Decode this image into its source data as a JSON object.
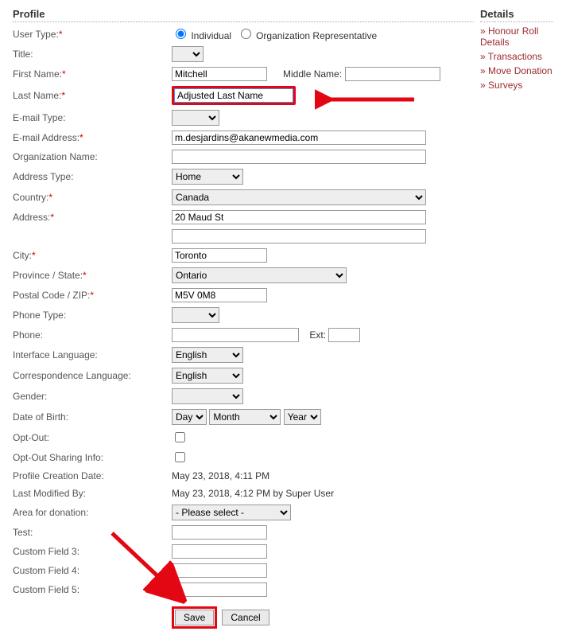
{
  "section_title_profile": "Profile",
  "section_title_details": "Details",
  "details_links": [
    "Honour Roll Details",
    "Transactions",
    "Move Donation",
    "Surveys"
  ],
  "userType": {
    "label": "User Type:",
    "req": true,
    "opt1": "Individual",
    "opt2": "Organization Representative",
    "selected": "Individual"
  },
  "title": {
    "label": "Title:",
    "value": ""
  },
  "firstName": {
    "label": "First Name:",
    "req": true,
    "value": "Mitchell"
  },
  "middleName": {
    "label": "Middle Name:",
    "value": ""
  },
  "lastName": {
    "label": "Last Name:",
    "req": true,
    "value": "Adjusted Last Name"
  },
  "emailType": {
    "label": "E-mail Type:",
    "value": ""
  },
  "emailAddress": {
    "label": "E-mail Address:",
    "req": true,
    "value": "m.desjardins@akanewmedia.com"
  },
  "orgName": {
    "label": "Organization Name:",
    "value": ""
  },
  "addressType": {
    "label": "Address Type:",
    "value": "Home"
  },
  "country": {
    "label": "Country:",
    "req": true,
    "value": "Canada"
  },
  "address": {
    "label": "Address:",
    "req": true,
    "line1": "20 Maud St",
    "line2": ""
  },
  "city": {
    "label": "City:",
    "req": true,
    "value": "Toronto"
  },
  "province": {
    "label": "Province / State:",
    "req": true,
    "value": "Ontario"
  },
  "postal": {
    "label": "Postal Code / ZIP:",
    "req": true,
    "value": "M5V 0M8"
  },
  "phoneType": {
    "label": "Phone Type:",
    "value": ""
  },
  "phone": {
    "label": "Phone:",
    "value": "",
    "extLabel": "Ext:",
    "ext": ""
  },
  "ifaceLang": {
    "label": "Interface Language:",
    "value": "English"
  },
  "corrLang": {
    "label": "Correspondence Language:",
    "value": "English"
  },
  "gender": {
    "label": "Gender:",
    "value": ""
  },
  "dob": {
    "label": "Date of Birth:",
    "day": "Day",
    "month": "Month",
    "year": "Year"
  },
  "optOut": {
    "label": "Opt-Out:",
    "checked": false
  },
  "optOutSharing": {
    "label": "Opt-Out Sharing Info:",
    "checked": false
  },
  "createdDate": {
    "label": "Profile Creation Date:",
    "value": "May 23, 2018, 4:11 PM"
  },
  "lastModified": {
    "label": "Last Modified By:",
    "value": "May 23, 2018, 4:12 PM by Super User"
  },
  "donationArea": {
    "label": "Area for donation:",
    "value": "- Please select -"
  },
  "test": {
    "label": "Test:",
    "value": ""
  },
  "cf3": {
    "label": "Custom Field 3:",
    "value": ""
  },
  "cf4": {
    "label": "Custom Field 4:",
    "value": ""
  },
  "cf5": {
    "label": "Custom Field 5:",
    "value": ""
  },
  "buttons": {
    "save": "Save",
    "cancel": "Cancel"
  }
}
